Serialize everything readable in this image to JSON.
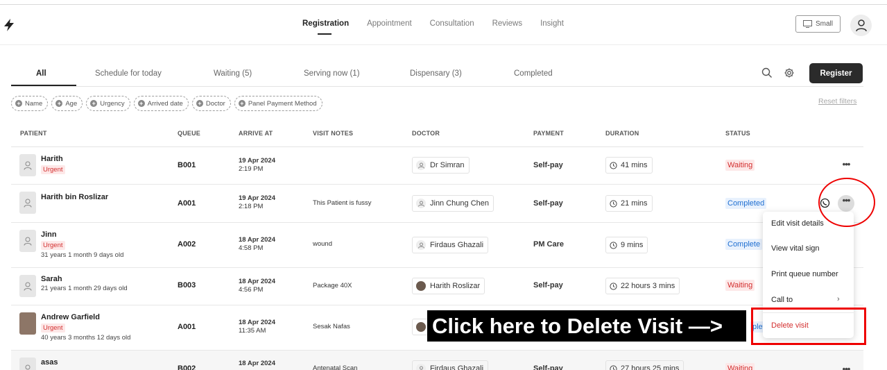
{
  "topnav": {
    "items": [
      {
        "label": "Registration",
        "active": true
      },
      {
        "label": "Appointment",
        "active": false
      },
      {
        "label": "Consultation",
        "active": false
      },
      {
        "label": "Reviews",
        "active": false
      },
      {
        "label": "Insight",
        "active": false
      }
    ],
    "size_label": "Small"
  },
  "subtabs": [
    {
      "label": "All"
    },
    {
      "label": "Schedule for today"
    },
    {
      "label": "Waiting (5)"
    },
    {
      "label": "Serving now (1)"
    },
    {
      "label": "Dispensary (3)"
    },
    {
      "label": "Completed"
    }
  ],
  "register_label": "Register",
  "filters": [
    "Name",
    "Age",
    "Urgency",
    "Arrived date",
    "Doctor",
    "Panel Payment Method"
  ],
  "reset_filters": "Reset filters",
  "columns": [
    "PATIENT",
    "QUEUE",
    "ARRIVE AT",
    "VISIT NOTES",
    "DOCTOR",
    "PAYMENT",
    "DURATION",
    "STATUS"
  ],
  "rows": [
    {
      "name": "Harith",
      "urgent": "Urgent",
      "age": "",
      "queue": "B001",
      "date": "19 Apr 2024",
      "time": "2:19 PM",
      "notes": "",
      "doctor": "Dr Simran",
      "payment": "Self-pay",
      "duration": "41 mins",
      "status": "Waiting"
    },
    {
      "name": "Harith bin Roslizar",
      "urgent": "",
      "age": "",
      "queue": "A001",
      "date": "19 Apr 2024",
      "time": "2:18 PM",
      "notes": "This Patient is fussy",
      "doctor": "Jinn Chung Chen",
      "payment": "Self-pay",
      "duration": "21 mins",
      "status": "Completed"
    },
    {
      "name": "Jinn",
      "urgent": "Urgent",
      "age": "31 years 1 month 9 days old",
      "queue": "A002",
      "date": "18 Apr 2024",
      "time": "4:58 PM",
      "notes": "wound",
      "doctor": "Firdaus Ghazali",
      "payment": "PM Care",
      "duration": "9 mins",
      "status": "Complete"
    },
    {
      "name": "Sarah",
      "urgent": "",
      "age": "21 years 1 month 29 days old",
      "queue": "B003",
      "date": "18 Apr 2024",
      "time": "4:56 PM",
      "notes": "Package 40X",
      "doctor": "Harith Roslizar",
      "payment": "Self-pay",
      "duration": "22 hours 3 mins",
      "status": "Waiting"
    },
    {
      "name": "Andrew Garfield",
      "urgent": "Urgent",
      "age": "40 years 3 months 12 days old",
      "queue": "A001",
      "date": "18 Apr 2024",
      "time": "11:35 AM",
      "notes": "Sesak Nafas",
      "doctor": "",
      "payment": "",
      "duration": "",
      "status": "plete"
    },
    {
      "name": "asas",
      "urgent": "",
      "age": "",
      "queue": "B002",
      "date": "18 Apr 2024",
      "time": "",
      "notes": "Antenatal Scan",
      "doctor": "Firdaus Ghazali",
      "payment": "Self-pay",
      "duration": "27 hours 25 mins",
      "status": "Waiting"
    }
  ],
  "menu": {
    "items": [
      "Edit visit details",
      "View vital sign",
      "Print queue number",
      "Call to",
      "Delete visit"
    ]
  },
  "annotation": {
    "label": "Click here to Delete Visit —>",
    "color": "#ee0000"
  }
}
